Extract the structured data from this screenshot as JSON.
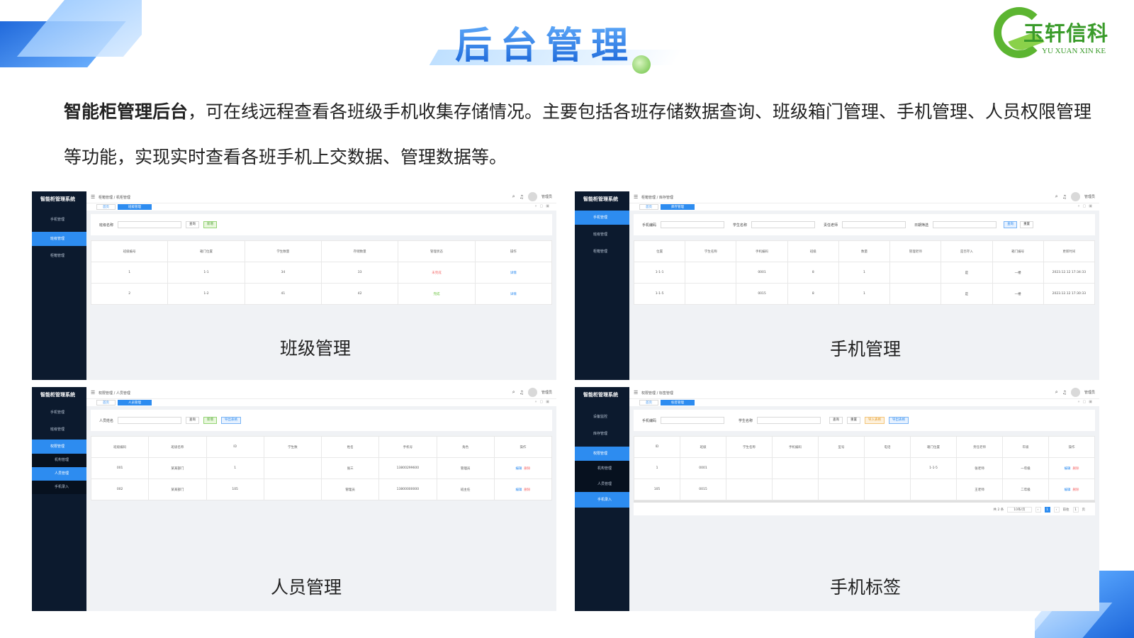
{
  "header": {
    "title": "后台管理",
    "logo_cn": "玉轩信科",
    "logo_en": "YU XUAN XIN KE"
  },
  "intro": {
    "bold": "智能柜管理后台",
    "text": "，可在线远程查看各班级手机收集存储情况。主要包括各班存储数据查询、班级箱门管理、手机管理、人员权限管理等功能，实现实时查看各班手机上交数据、管理数据等。"
  },
  "colors": {
    "sidebar_bg": "#0c1a2e",
    "accent": "#2d8cf0",
    "title_blue": "#1561d6",
    "logo_green": "#5cb531"
  },
  "panels": {
    "class": {
      "caption": "班级管理",
      "app_title": "智能柜管理系统",
      "sidebar": [
        "手机管理",
        "班级管理",
        "柜箱管理"
      ],
      "breadcrumb": "柜箱管理 / 机柜管理",
      "user": "管理员",
      "tabs": [
        "首页",
        "班级管理"
      ],
      "search_label": "班级名称",
      "buttons": [
        "查询",
        "新增"
      ],
      "columns": [
        "班级编号",
        "箱门位置",
        "学生数量",
        "存储数量",
        "管理状态",
        "操作"
      ],
      "rows": [
        [
          "1",
          "1-1",
          "34",
          "33",
          "未完成",
          "详情"
        ],
        [
          "2",
          "1-2",
          "41",
          "42",
          "完成",
          "详情"
        ]
      ]
    },
    "phone": {
      "caption": "手机管理",
      "app_title": "智能柜管理系统",
      "sidebar": [
        "手机管理",
        "班级管理",
        "柜箱管理"
      ],
      "breadcrumb": "柜箱管理 / 库存管理",
      "user": "管理员",
      "tabs": [
        "首页",
        "库存管理"
      ],
      "search_labels": [
        "手机编码",
        "学生名称",
        "责任老师",
        "日期筛选"
      ],
      "buttons": [
        "查询",
        "重置"
      ],
      "columns": [
        "位置",
        "学生名称",
        "手机编码",
        "班级",
        "数量",
        "管理老师",
        "是否存入",
        "箱门编号",
        "更新时间"
      ],
      "rows": [
        [
          "1-1-1",
          "",
          "0001",
          "8",
          "1",
          "",
          "是",
          "一楼",
          "2023.12.12 17:34:33"
        ],
        [
          "1-1-5",
          "",
          "0015",
          "8",
          "1",
          "",
          "是",
          "一楼",
          "2023.12.12 17:30:33"
        ]
      ]
    },
    "people": {
      "caption": "人员管理",
      "app_title": "智能柜管理系统",
      "sidebar": [
        "手机管理",
        "班级管理",
        "权限管理",
        "机构管理",
        "人员管理",
        "手机录入"
      ],
      "breadcrumb": "权限管理 / 人员管理",
      "user": "管理员",
      "tabs": [
        "首页",
        "人员管理"
      ],
      "search_label": "人员姓名",
      "buttons": [
        "查询",
        "新增",
        "导出表格"
      ],
      "columns": [
        "班级编码",
        "班级名称",
        "ID",
        "学生数",
        "姓名",
        "手机号",
        "角色",
        "操作"
      ],
      "rows": [
        [
          "001",
          "某某部门",
          "1",
          "",
          "张三",
          "13800299600",
          "管理员",
          "编辑",
          "删除"
        ],
        [
          "002",
          "某某部门",
          "105",
          "",
          "管理员",
          "13800000000",
          "班主任",
          "编辑",
          "删除"
        ]
      ]
    },
    "label": {
      "caption": "手机标签",
      "app_title": "智能柜管理系统",
      "sidebar": [
        "设备监控",
        "库存管理",
        "权限管理",
        "机构管理",
        "人员管理",
        "手机录入"
      ],
      "breadcrumb": "权限管理 / 标签管理",
      "user": "管理员",
      "tabs": [
        "首页",
        "标签管理"
      ],
      "search_labels": [
        "手机编码",
        "学生名称"
      ],
      "buttons": [
        "查询",
        "重置",
        "导入表格",
        "导出表格"
      ],
      "columns": [
        "ID",
        "班级",
        "学生名称",
        "手机编码",
        "型号",
        "电话",
        "箱门位置",
        "责任老师",
        "年级",
        "操作"
      ],
      "rows": [
        [
          "1",
          "0001",
          "",
          "",
          "",
          "",
          "1-1-5",
          "张老师",
          "一年级",
          "编辑",
          "删除"
        ],
        [
          "105",
          "0015",
          "",
          "",
          "",
          "",
          "",
          "王老师",
          "二年级",
          "编辑",
          "删除"
        ]
      ],
      "pager": {
        "total": "共 2 条",
        "size": "10条/页",
        "page": "1",
        "goto": "前往",
        "goto_page": "1",
        "unit": "页"
      }
    }
  }
}
